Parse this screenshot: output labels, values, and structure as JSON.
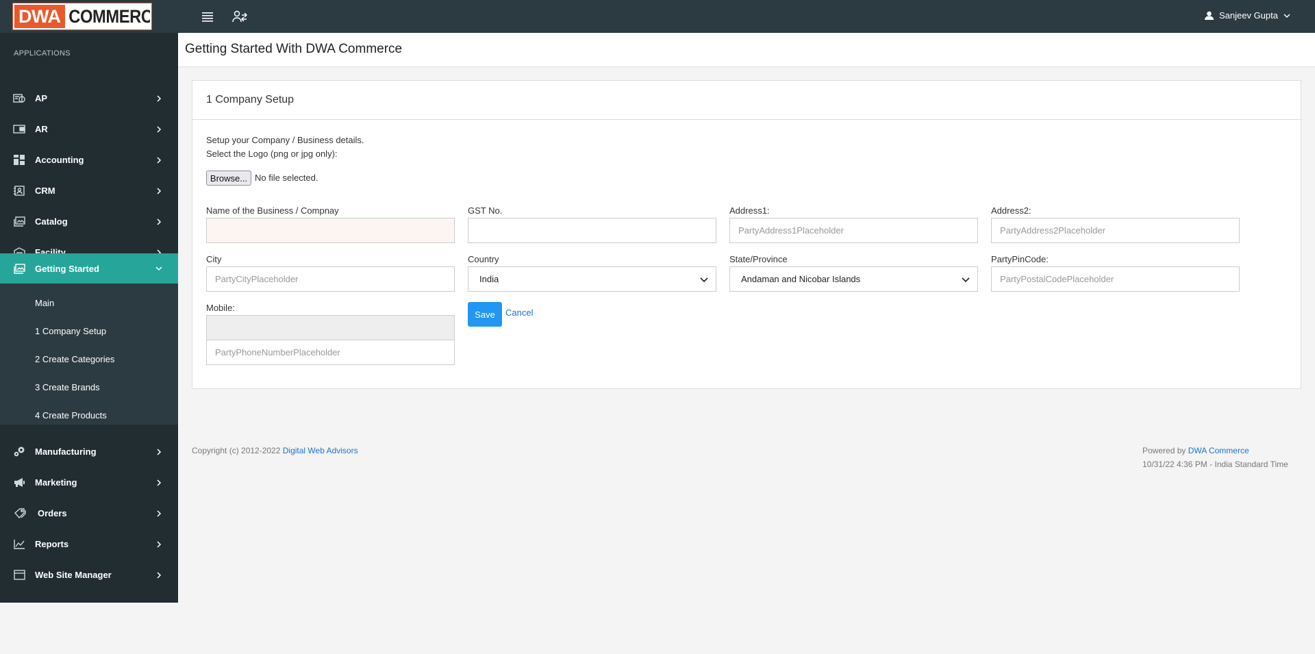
{
  "header": {
    "logo_part1": "DWA",
    "logo_part2": "COMMERCE",
    "user_name": "Sanjeev Gupta"
  },
  "sidebar": {
    "section_title": "APPLICATIONS",
    "items": [
      {
        "label": "AP",
        "icon": "ap-icon"
      },
      {
        "label": "AR",
        "icon": "ar-icon"
      },
      {
        "label": "Accounting",
        "icon": "accounting-icon"
      },
      {
        "label": "CRM",
        "icon": "crm-icon"
      },
      {
        "label": "Catalog",
        "icon": "catalog-icon"
      },
      {
        "label": "Facility",
        "icon": "facility-icon"
      },
      {
        "label": "Getting Started",
        "icon": "getting-started-icon",
        "active": true
      },
      {
        "label": "Manufacturing",
        "icon": "manufacturing-icon"
      },
      {
        "label": "Marketing",
        "icon": "marketing-icon"
      },
      {
        "label": "Orders",
        "icon": "orders-icon"
      },
      {
        "label": "Reports",
        "icon": "reports-icon"
      },
      {
        "label": "Web Site Manager",
        "icon": "web-site-manager-icon"
      }
    ],
    "submenu": [
      "Main",
      "1 Company Setup",
      "2 Create Categories",
      "3 Create Brands",
      "4 Create Products"
    ]
  },
  "page": {
    "title": "Getting Started With DWA Commerce"
  },
  "card": {
    "title": "1 Company Setup",
    "intro_line1": "Setup your Company / Business details.",
    "intro_line2": "Select the Logo (png or jpg only):",
    "browse_label": "Browse...",
    "file_status": "No file selected."
  },
  "form": {
    "business_name": {
      "label": "Name of the Business / Compnay",
      "value": "",
      "placeholder": ""
    },
    "gst": {
      "label": "GST No.",
      "value": "",
      "placeholder": ""
    },
    "address1": {
      "label": "Address1:",
      "placeholder": "PartyAddress1Placeholder"
    },
    "address2": {
      "label": "Address2:",
      "placeholder": "PartyAddress2Placeholder"
    },
    "city": {
      "label": "City",
      "placeholder": "PartyCityPlaceholder"
    },
    "country": {
      "label": "Country",
      "value": "India"
    },
    "state": {
      "label": "State/Province",
      "value": "Andaman and Nicobar Islands"
    },
    "pincode": {
      "label": "PartyPinCode:",
      "placeholder": "PartyPostalCodePlaceholder"
    },
    "mobile": {
      "label": "Mobile:",
      "code_value": "",
      "placeholder": "PartyPhoneNumberPlaceholder"
    },
    "save_label": "Save",
    "cancel_label": "Cancel"
  },
  "footer": {
    "copyright": "Copyright (c) 2012-2022",
    "copyright_link": "Digital Web Advisors",
    "powered_by": "Powered by",
    "powered_link": "DWA Commerce",
    "timestamp": "10/31/22 4:36 PM - India Standard Time"
  },
  "colors": {
    "topbar": "#2c3b41",
    "sidebar": "#222d32",
    "active": "#26a69a",
    "accent": "#2196f3",
    "logo": "#e8592c"
  }
}
